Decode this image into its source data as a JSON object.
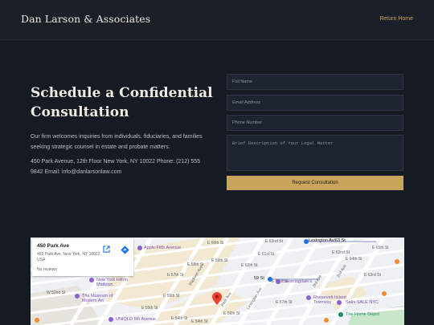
{
  "header": {
    "brand": "Dan Larson & Associates",
    "return_link": "Return Home"
  },
  "intro": {
    "title": "Schedule a Confidential Consultation",
    "description": "Our firm welcomes inquiries from individuals, fiduciaries, and families seeking strategic counsel in estate and probate matters.",
    "contact": "450 Park Avenue, 12th Floor New York, NY 10022 Phone: (212) 555 9842 Email: info@danlarsonlaw.com"
  },
  "form": {
    "name_placeholder": "Full Name",
    "email_placeholder": "Email Address",
    "phone_placeholder": "Phone Number",
    "matter_placeholder": "Brief Description of Your Legal Matter",
    "submit_label": "Request Consultation"
  },
  "map": {
    "card": {
      "title": "450 Park Ave",
      "address": "450 Park Ave, New York, NY 10022, USA",
      "reviews": "No reviews"
    },
    "streets": [
      "E 60th St",
      "E 62nd St",
      "E 61st St",
      "E 60th St",
      "E 59th St",
      "E 58th St",
      "E 57th St",
      "E 56th St",
      "E 55th St",
      "E 54th St",
      "E 58th St",
      "E 57th St",
      "E 56th St",
      "W 52nd St",
      "E 54th St",
      "E 64th St",
      "E 65th St",
      "E 63rd St",
      "E 62nd St",
      "Park Ave",
      "Madison Ave",
      "Lexington Ave",
      "3rd Ave",
      "2nd Ave",
      "59 St"
    ],
    "places": {
      "apple": "Apple Fifth Avenue",
      "hilton": "New York Hilton Midtown",
      "moma": "The Museum of Modern Art",
      "uniqlo": "UNIQLO 5th Avenue",
      "bloomingdales": "Bloomingdale's",
      "lexington": "Lexington Av/63 St",
      "roosevelt": "Roosevelt Island Tramway",
      "saks": "Saks SALE NYC",
      "homedepot": "The Home Depot"
    },
    "colors": {
      "pin": "#ea4335",
      "place": "#7b4fb5",
      "park": "#c8e6c9",
      "road": "#ffffff",
      "accent": "#c9a45c"
    }
  }
}
